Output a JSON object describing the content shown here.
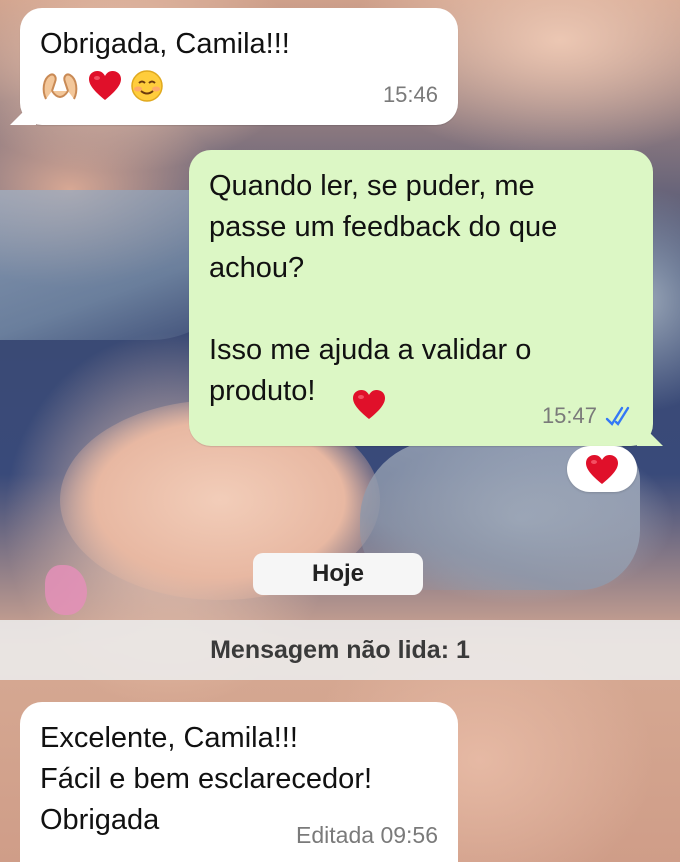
{
  "messages": [
    {
      "direction": "in",
      "text": "Obrigada, Camila!!!",
      "emojis": [
        "heart-hands-emoji",
        "red-heart-emoji",
        "smiling-face-emoji"
      ],
      "time": "15:46"
    },
    {
      "direction": "out",
      "text": "Quando ler, se puder, me\npasse um feedback do que\nachou?\n\nIsso me ajuda a validar o\nproduto!",
      "time": "15:47",
      "status": "read",
      "reaction": "red-heart-emoji"
    },
    {
      "direction": "in",
      "text": "Excelente, Camila!!!\nFácil e bem esclarecedor!\nObrigada",
      "time": "Editada 09:56"
    }
  ],
  "date_separator": "Hoje",
  "unread_banner": "Mensagem não lida: 1",
  "colors": {
    "incoming_bubble": "#ffffff",
    "outgoing_bubble": "#dcf7c5",
    "read_ticks": "#3478f6",
    "heart": "#e0102a"
  }
}
